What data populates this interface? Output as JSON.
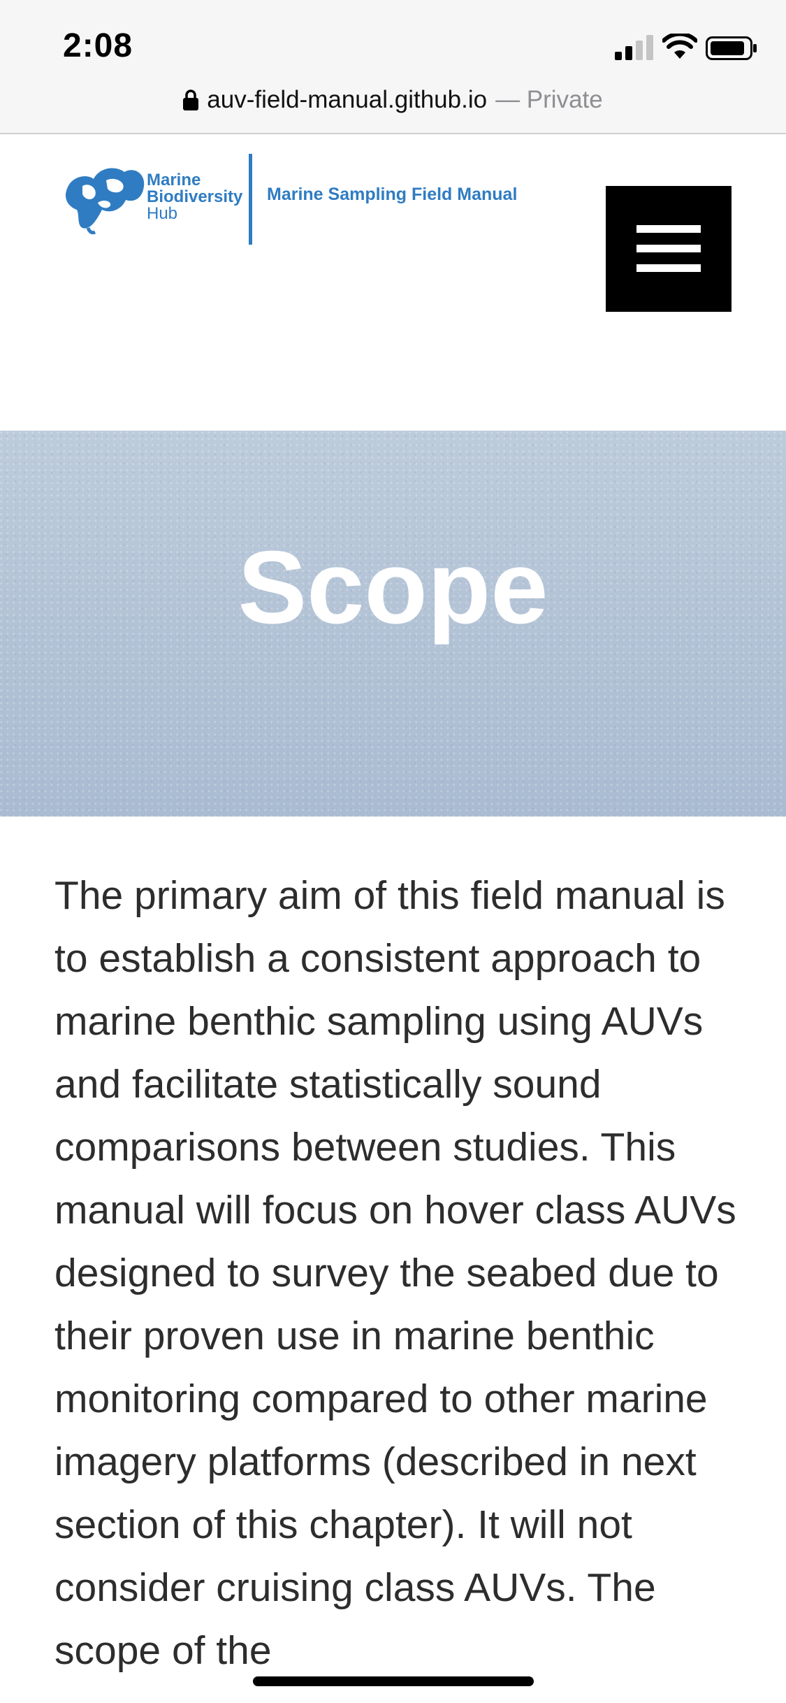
{
  "status_bar": {
    "time": "2:08",
    "url": "auv-field-manual.github.io",
    "private_label": "— Private"
  },
  "header": {
    "logo_line1": "Marine",
    "logo_line2": "Biodiversity",
    "logo_line3": "Hub",
    "manual_title": "Marine Sampling Field Manual",
    "brand_color": "#2f7cc2",
    "menu_icon": "hamburger-menu-icon"
  },
  "hero": {
    "title": "Scope"
  },
  "content": {
    "paragraph": "The primary aim of this field manual is to establish a consistent approach to marine benthic sampling using AUVs and facilitate statistically sound comparisons between studies. This manual will focus on hover class AUVs designed to survey the seabed due to their proven use in marine benthic monitoring compared to other marine imagery platforms (described in next section of this chapter). It will not consider cruising class AUVs. The scope of the"
  }
}
